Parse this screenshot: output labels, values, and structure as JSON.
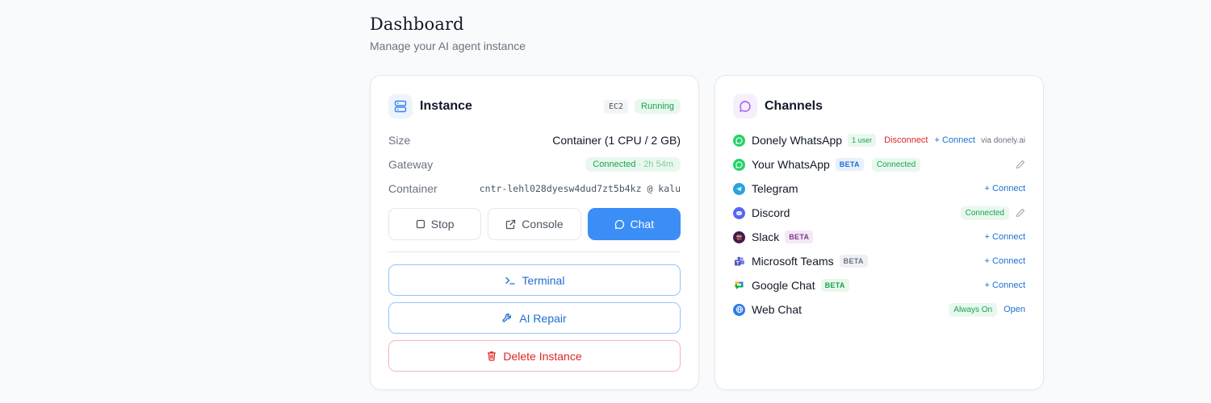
{
  "page": {
    "title": "Dashboard",
    "subtitle": "Manage your AI agent instance"
  },
  "instance": {
    "title": "Instance",
    "type_tag": "EC2",
    "status": "Running",
    "rows": {
      "size_label": "Size",
      "size_value": "Container (1 CPU / 2 GB)",
      "gateway_label": "Gateway",
      "gateway_status": "Connected",
      "gateway_uptime": "· 2h 54m",
      "container_label": "Container",
      "container_value": "cntr-lehl028dyesw4dud7zt5b4kz @ kalu"
    },
    "buttons": {
      "stop": "Stop",
      "console": "Console",
      "chat": "Chat"
    },
    "actions": {
      "terminal": "Terminal",
      "ai_repair": "AI Repair",
      "delete": "Delete Instance"
    }
  },
  "channels": {
    "title": "Channels",
    "items": [
      {
        "name": "Donely WhatsApp",
        "badge": "1 user",
        "disconnect": "Disconnect",
        "connect": "+ Connect",
        "via": "via donely.ai"
      },
      {
        "name": "Your WhatsApp",
        "badge": "BETA",
        "status": "Connected"
      },
      {
        "name": "Telegram",
        "connect": "+ Connect"
      },
      {
        "name": "Discord",
        "status": "Connected"
      },
      {
        "name": "Slack",
        "badge": "BETA",
        "connect": "+ Connect"
      },
      {
        "name": "Microsoft Teams",
        "badge": "BETA",
        "connect": "+ Connect"
      },
      {
        "name": "Google Chat",
        "badge": "BETA",
        "connect": "+ Connect"
      },
      {
        "name": "Web Chat",
        "status": "Always On",
        "open": "Open"
      }
    ]
  },
  "colors": {
    "accent": "#3b8ef6",
    "success": "#16a34a",
    "danger": "#dc2626",
    "link": "#1d6fd1"
  },
  "icons": {
    "instance": "server-icon",
    "channels": "chat-bubble-icon",
    "stop": "square-icon",
    "console": "external-link-icon",
    "chat": "chat-bubble-icon",
    "terminal": "terminal-prompt-icon",
    "ai_repair": "wrench-icon",
    "delete": "trash-icon",
    "edit": "pencil-icon"
  }
}
